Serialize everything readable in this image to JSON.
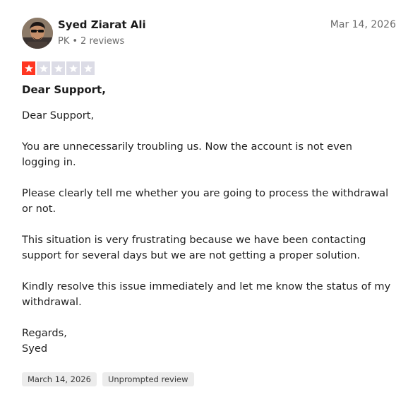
{
  "reviewer": {
    "name": "Syed Ziarat Ali",
    "country": "PK",
    "separator": "•",
    "reviews_count": "2 reviews"
  },
  "review": {
    "date": "Mar 14, 2026",
    "rating": 1,
    "rating_max": 5,
    "title": "Dear Support,",
    "paragraphs": [
      "Dear Support,",
      "You are unnecessarily troubling us. Now the account is not even logging in.",
      "Please clearly tell me whether you are going to process the withdrawal or not.",
      "This situation is very frustrating because we have been contacting support for several days but we are not getting a proper solution.",
      "Kindly resolve this issue immediately and let me know the status of my withdrawal."
    ],
    "closing": [
      "Regards,",
      "Syed"
    ]
  },
  "tags": {
    "experience_date": "March 14, 2026",
    "review_type": "Unprompted review"
  },
  "colors": {
    "star_filled": "#ff3722",
    "star_empty": "#dcdce6",
    "tag_bg": "#ececec",
    "muted_text": "#6b6b6b"
  }
}
